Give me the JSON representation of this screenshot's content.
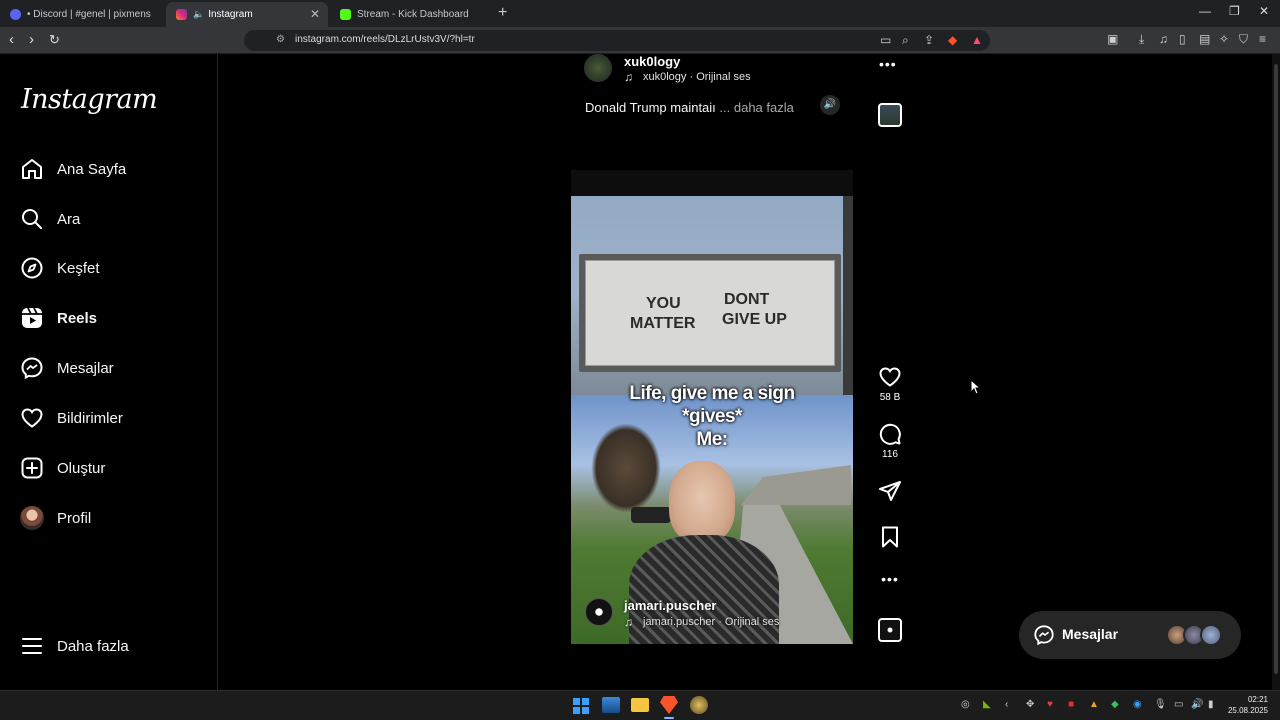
{
  "browser": {
    "tabs": [
      {
        "label": "• Discord | #genel | pixmens",
        "color": "#5865f2"
      },
      {
        "label": "Instagram",
        "color": "#e1306c"
      },
      {
        "label": "Stream - Kick Dashboard",
        "color": "#53fc18"
      }
    ],
    "url": "instagram.com/reels/DLzLrUstv3V/?hl=tr"
  },
  "sidebar": {
    "logo": "Instagram",
    "items": [
      {
        "label": "Ana Sayfa",
        "icon": "home-icon"
      },
      {
        "label": "Ara",
        "icon": "search-icon"
      },
      {
        "label": "Keşfet",
        "icon": "compass-icon"
      },
      {
        "label": "Reels",
        "icon": "reels-icon"
      },
      {
        "label": "Mesajlar",
        "icon": "messenger-icon"
      },
      {
        "label": "Bildirimler",
        "icon": "heart-icon"
      },
      {
        "label": "Oluştur",
        "icon": "plus-square-icon"
      },
      {
        "label": "Profil",
        "icon": "avatar"
      }
    ],
    "more": "Daha fazla"
  },
  "prev_reel": {
    "author": "xuk0logy",
    "audio": "xuk0logy · Orijinal ses",
    "caption": "Donald Trump maintaiı",
    "more": "... daha fazla"
  },
  "reel": {
    "sign_line1_left": "YOU",
    "sign_line1_right": "DONT",
    "sign_line2_left": "MATTER",
    "sign_line2_right": "GIVE UP",
    "overlay_line1": "Life, give me a sign",
    "overlay_line2": "*gives*",
    "overlay_line3": "Me:",
    "author": "jamari.puscher",
    "audio": "jamari.puscher · Orijinal ses",
    "likes": "58 B",
    "comments": "116"
  },
  "messages_popup": {
    "label": "Mesajlar"
  },
  "taskbar": {
    "time": "02:21",
    "date": "25.08.2025"
  }
}
